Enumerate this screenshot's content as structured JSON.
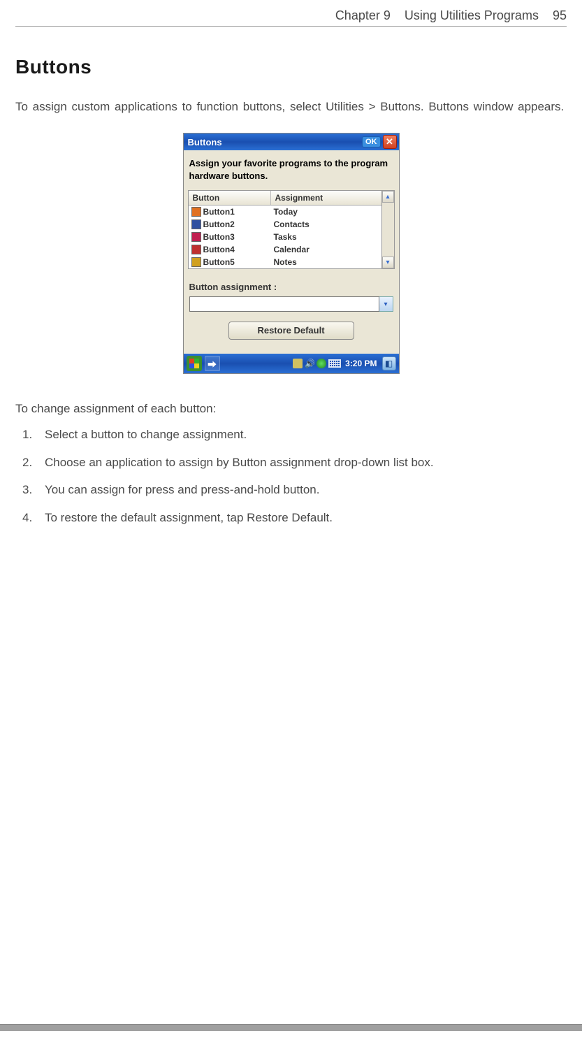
{
  "header": {
    "chapter": "Chapter 9",
    "title": "Using Utilities Programs",
    "page": "95"
  },
  "section": {
    "heading": "Buttons",
    "intro": "To assign custom applications to function buttons, select Utilities > Buttons. Buttons window appears."
  },
  "screenshot": {
    "titlebar": {
      "title": "Buttons",
      "ok": "OK"
    },
    "instruction": "Assign your favorite programs to the program hardware buttons.",
    "table": {
      "headers": {
        "col1": "Button",
        "col2": "Assignment"
      },
      "rows": [
        {
          "icon": "home-icon",
          "icon_color": "#e07020",
          "button": "Button1",
          "assignment": "Today"
        },
        {
          "icon": "contacts-icon",
          "icon_color": "#3050a0",
          "button": "Button2",
          "assignment": "Contacts"
        },
        {
          "icon": "tasks-icon",
          "icon_color": "#c02050",
          "button": "Button3",
          "assignment": "Tasks"
        },
        {
          "icon": "calendar-icon",
          "icon_color": "#c03030",
          "button": "Button4",
          "assignment": "Calendar"
        },
        {
          "icon": "notes-icon",
          "icon_color": "#d0a020",
          "button": "Button5",
          "assignment": "Notes"
        }
      ]
    },
    "assignment": {
      "label": "Button assignment :",
      "value": ""
    },
    "restore_label": "Restore Default",
    "taskbar": {
      "time": "3:20 PM"
    }
  },
  "instructions": {
    "heading": "To change assignment of each button:",
    "steps": [
      "Select a button to change assignment.",
      "Choose an application to assign by Button assignment drop-down list box.",
      "You can assign for press and press-and-hold button.",
      "To restore the default assignment, tap Restore Default."
    ]
  }
}
